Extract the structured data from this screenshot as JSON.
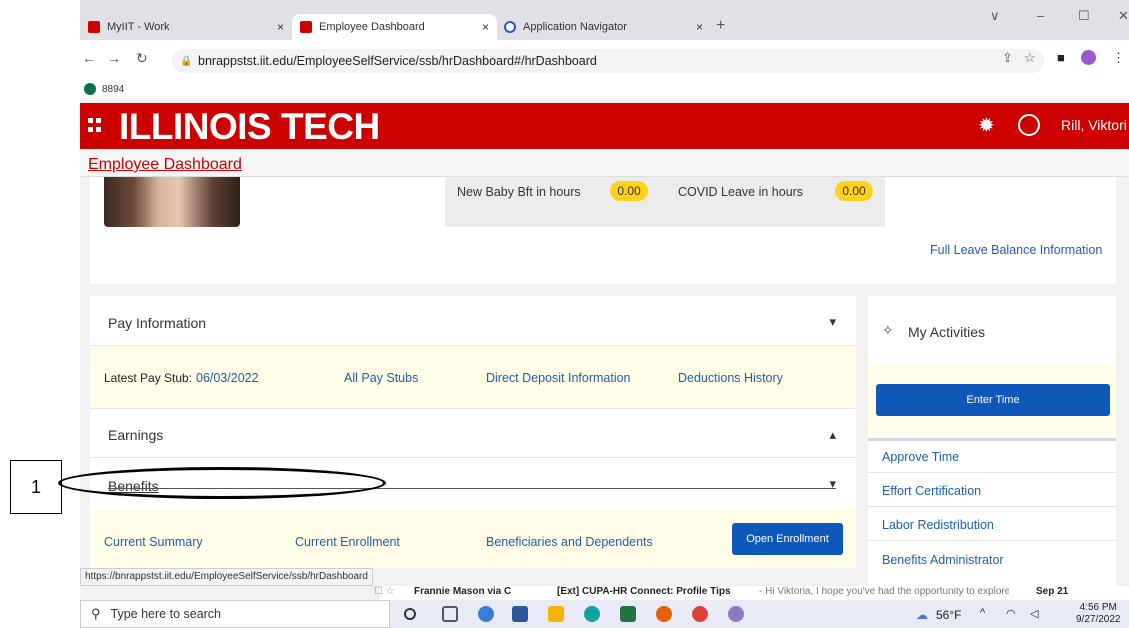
{
  "tabs": [
    {
      "label": "MyIIT - Work",
      "close": "×"
    },
    {
      "label": "Employee Dashboard",
      "close": "×"
    },
    {
      "label": "Application Navigator",
      "close": "×"
    }
  ],
  "new_tab": "+",
  "window_controls": {
    "chevron": "∨",
    "minimize": "–",
    "maximize": "☐",
    "close": "✕"
  },
  "address": {
    "url": "bnrappstst.iit.edu/EmployeeSelfService/ssb/hrDashboard#/hrDashboard"
  },
  "bookmark": {
    "label": "8894"
  },
  "header": {
    "brand": "ILLINOIS TECH",
    "user": "Rill, Viktori"
  },
  "breadcrumb": "Employee Dashboard",
  "leave": {
    "items": [
      {
        "label": "New Baby Bft in hours",
        "value": "0.00"
      },
      {
        "label": "COVID Leave in hours",
        "value": "0.00"
      }
    ],
    "full_link": "Full Leave Balance Information"
  },
  "pay": {
    "title": "Pay Information",
    "latest_label": "Latest Pay Stub:",
    "latest_date": "06/03/2022",
    "links": [
      "All Pay Stubs",
      "Direct Deposit Information",
      "Deductions History"
    ]
  },
  "earnings": {
    "title": "Earnings"
  },
  "benefits": {
    "title": "Benefits",
    "links": [
      "Current Summary",
      "Current Enrollment",
      "Beneficiaries and Dependents"
    ],
    "button": "Open Enrollment"
  },
  "activities": {
    "title": "My Activities",
    "button": "Enter Time",
    "items": [
      "Approve Time",
      "Effort Certification",
      "Labor Redistribution",
      "Benefits Administrator"
    ]
  },
  "status_url": "https://bnrappstst.iit.edu/EmployeeSelfService/ssb/hrDashboard",
  "mail_peek": {
    "sender": "Frannie Mason via C",
    "subject": "[Ext] CUPA-HR Connect: Profile Tips",
    "preview": " - Hi Viktoria, I hope you've had the opportunity to explore CUPA-HR Co",
    "date": "Sep 21"
  },
  "taskbar": {
    "search": "Type here to search",
    "weather": "56°F",
    "time": "4:56 PM",
    "date": "9/27/2022"
  },
  "annotation": {
    "number": "1"
  }
}
